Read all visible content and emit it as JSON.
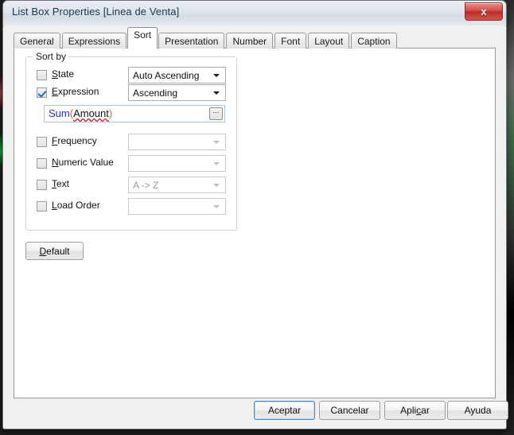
{
  "window": {
    "title": "List Box Properties [Linea de Venta]",
    "close_label": "x",
    "close_icon": "close-icon"
  },
  "tabs": [
    {
      "label": "General",
      "active": false
    },
    {
      "label": "Expressions",
      "active": false
    },
    {
      "label": "Sort",
      "active": true
    },
    {
      "label": "Presentation",
      "active": false
    },
    {
      "label": "Number",
      "active": false
    },
    {
      "label": "Font",
      "active": false
    },
    {
      "label": "Layout",
      "active": false
    },
    {
      "label": "Caption",
      "active": false
    }
  ],
  "sort_group": {
    "legend": "Sort by",
    "rows": [
      {
        "label_pre": "",
        "label_accel": "S",
        "label_post": "tate",
        "checked": false,
        "combo_value": "Auto Ascending",
        "combo_enabled": true
      },
      {
        "label_pre": "",
        "label_accel": "E",
        "label_post": "xpression",
        "checked": true,
        "combo_value": "Ascending",
        "combo_enabled": true
      },
      {
        "label_pre": "",
        "label_accel": "F",
        "label_post": "requency",
        "checked": false,
        "combo_value": "",
        "combo_enabled": false
      },
      {
        "label_pre": "",
        "label_accel": "N",
        "label_post": "umeric Value",
        "checked": false,
        "combo_value": "",
        "combo_enabled": false
      },
      {
        "label_pre": "",
        "label_accel": "T",
        "label_post": "ext",
        "checked": false,
        "combo_value": "A -> Z",
        "combo_enabled": false
      },
      {
        "label_pre": "",
        "label_accel": "L",
        "label_post": "oad Order",
        "checked": false,
        "combo_value": "",
        "combo_enabled": false
      }
    ],
    "expression": {
      "function": "Sum",
      "open_paren": "(",
      "argument": "Amount",
      "close_paren": ")",
      "browse_label": "...",
      "function_color": "#2b2bd4",
      "paren_color": "#e06a10",
      "argument_underline_color": "#d01818"
    }
  },
  "default_button": {
    "accel": "D",
    "rest": "efault"
  },
  "dialog_buttons": [
    {
      "label_pre": "Aceptar",
      "accel": "",
      "label_post": "",
      "default": true
    },
    {
      "label_pre": "Cancelar",
      "accel": "",
      "label_post": "",
      "default": false
    },
    {
      "label_pre": "Apli",
      "accel": "c",
      "label_post": "ar",
      "default": false
    },
    {
      "label_pre": "Ayuda",
      "accel": "",
      "label_post": "",
      "default": false
    }
  ]
}
